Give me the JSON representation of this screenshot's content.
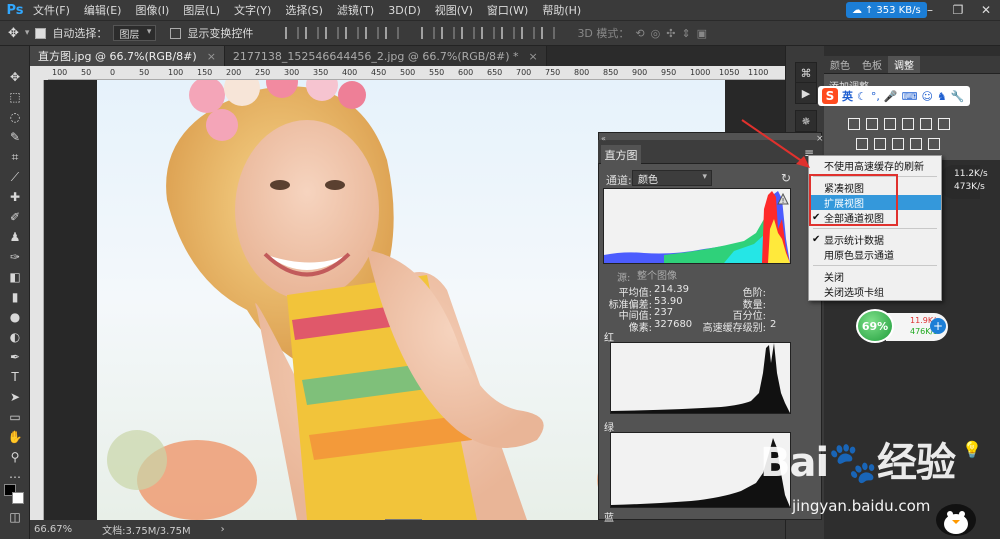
{
  "app": {
    "logo": "Ps",
    "menus": [
      "文件(F)",
      "编辑(E)",
      "图像(I)",
      "图层(L)",
      "文字(Y)",
      "选择(S)",
      "滤镜(T)",
      "3D(D)",
      "视图(V)",
      "窗口(W)",
      "帮助(H)"
    ],
    "window_controls": [
      "–",
      "❐",
      "✕"
    ]
  },
  "net_badge": "353 KB/s",
  "options_bar": {
    "auto_select_label": "自动选择：",
    "auto_select_value": "图层",
    "show_transform_label": "显示变换控件",
    "mode_3d_label": "3D 模式："
  },
  "tabs": [
    {
      "label": "直方图.jpg @ 66.7%(RGB/8#)",
      "close": "×"
    },
    {
      "label": "2177138_152546644456_2.jpg @ 66.7%(RGB/8#) *",
      "close": "×"
    }
  ],
  "ruler_ticks": [
    "100",
    "50",
    "0",
    "50",
    "100",
    "150",
    "200",
    "250",
    "300",
    "350",
    "400",
    "450",
    "500",
    "550",
    "600",
    "650",
    "700",
    "750",
    "800",
    "850",
    "900",
    "950",
    "1000",
    "1050",
    "1100"
  ],
  "status": {
    "zoom": "66.67%",
    "doc": "文档:3.75M/3.75M"
  },
  "right_panel": {
    "tabs": [
      "颜色",
      "色板",
      "调整"
    ],
    "adjust_title": "添加调整",
    "sogou_label": "英"
  },
  "histogram": {
    "tab": "直方图",
    "channel_label": "通道:",
    "channel_value": "颜色",
    "source_label": "源:",
    "source_value": "整个图像",
    "stats_left": [
      {
        "label": "平均值:",
        "value": "214.39"
      },
      {
        "label": "标准偏差:",
        "value": "53.90"
      },
      {
        "label": "中间值:",
        "value": "237"
      },
      {
        "label": "像素:",
        "value": "327680"
      }
    ],
    "stats_right": [
      {
        "label": "色阶:",
        "value": ""
      },
      {
        "label": "数量:",
        "value": ""
      },
      {
        "label": "百分位:",
        "value": ""
      },
      {
        "label": "高速缓存级别:",
        "value": "2"
      }
    ],
    "red_label": "红",
    "green_label": "绿",
    "blue_label": "蓝"
  },
  "context_menu": {
    "items": [
      {
        "label": "不使用高速缓存的刷新",
        "checked": false,
        "highlight": false
      },
      {
        "label": "紧凑视图",
        "checked": false,
        "highlight": false
      },
      {
        "label": "扩展视图",
        "checked": false,
        "highlight": true
      },
      {
        "label": "全部通道视图",
        "checked": true,
        "highlight": false
      },
      {
        "label": "显示统计数据",
        "checked": true,
        "highlight": false
      },
      {
        "label": "用原色显示通道",
        "checked": false,
        "highlight": false
      },
      {
        "label": "关闭",
        "checked": false,
        "highlight": false
      },
      {
        "label": "关闭选项卡组",
        "checked": false,
        "highlight": false
      }
    ]
  },
  "speed_widget_top": {
    "up": "11.2K/s",
    "down": "473K/s"
  },
  "speed_widget": {
    "percent": "69%",
    "up": "11.9K/s",
    "down": "476K/s",
    "plus": "+"
  },
  "watermark": {
    "brand": "Bai",
    "cn": "经验",
    "url": "jingyan.baidu.com"
  },
  "colors": {
    "accent": "#31a8ff",
    "highlight": "#3498db",
    "annotation": "#e0312d",
    "panel": "#535353"
  }
}
